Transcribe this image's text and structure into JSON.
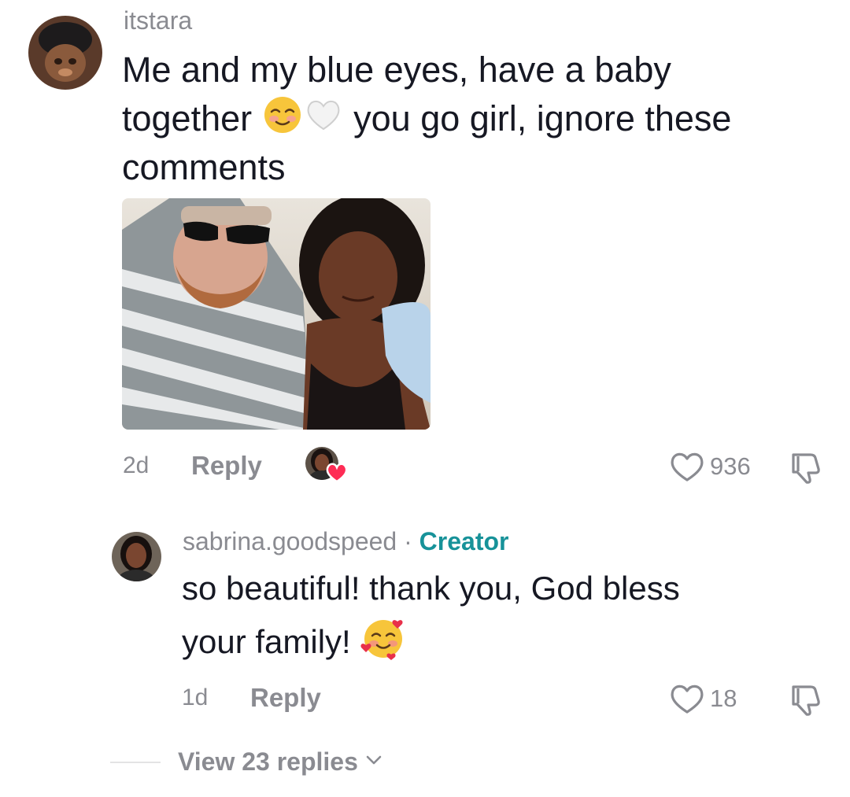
{
  "comment": {
    "username": "itstara",
    "text_line1": "Me and my blue eyes, have a baby",
    "text_line2_before": "together",
    "text_line2_after": " you go girl, ignore these",
    "text_line3": "comments",
    "time": "2d",
    "reply_label": "Reply",
    "like_count": "936",
    "creator_liked": true
  },
  "reply": {
    "username": "sabrina.goodspeed",
    "separator": " · ",
    "badge": "Creator",
    "text_line1": "so beautiful! thank you, God bless",
    "text_line2": "your family! ",
    "time": "1d",
    "reply_label": "Reply",
    "like_count": "18"
  },
  "view_replies": {
    "label": "View 23 replies"
  },
  "icons": {
    "heart_outline": "heart-outline-icon",
    "dislike": "thumbs-down-icon",
    "chevron": "chevron-down-icon",
    "emoji1": "smiling-face-emoji",
    "emoji2": "white-heart-emoji",
    "emoji3": "smiling-face-with-hearts-emoji"
  },
  "colors": {
    "text": "#161823",
    "muted": "#8a8b91",
    "creator": "#179299",
    "like_heart": "#fe2c55"
  }
}
